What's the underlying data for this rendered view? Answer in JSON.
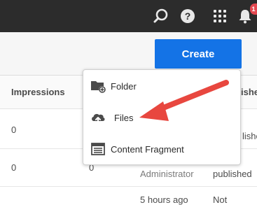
{
  "header": {
    "icons": [
      "search-icon",
      "help-icon",
      "apps-icon",
      "bell-icon"
    ],
    "notification_badge": "1"
  },
  "toolbar": {
    "create_label": "Create",
    "create_color": "#1473e6"
  },
  "table": {
    "columns": [
      "Impressions",
      "ished"
    ],
    "rows": [
      {
        "impressions": "0",
        "published": "lished"
      },
      {
        "impressions": "0",
        "views": "0",
        "modified_by": "Administrator",
        "published": "published"
      },
      {
        "modified": "5 hours ago",
        "published": "Not"
      }
    ]
  },
  "create_menu": {
    "items": [
      {
        "label": "Folder",
        "icon": "folder-add-icon"
      },
      {
        "label": "Files",
        "icon": "cloud-upload-icon"
      },
      {
        "label": "Content Fragment",
        "icon": "content-fragment-icon"
      }
    ]
  },
  "annotation": {
    "color": "#e8473f",
    "icon": "red-arrow-annotation"
  }
}
